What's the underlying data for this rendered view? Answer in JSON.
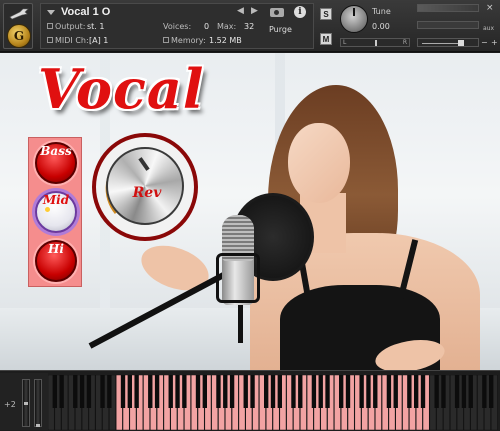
{
  "header": {
    "instrument_name": "Vocal 1 O",
    "output_label": "Output:",
    "output_value": "st. 1",
    "voices_label": "Voices:",
    "voices_value": "0",
    "max_label": "Max:",
    "max_value": "32",
    "purge_label": "Purge",
    "midi_label": "MIDI Ch:",
    "midi_value": "[A] 1",
    "memory_label": "Memory:",
    "memory_value": "1.52 MB",
    "solo_label": "S",
    "mute_label": "M",
    "tune_label": "Tune",
    "tune_value": "0.00",
    "aux_label": "aux",
    "pan_left": "L",
    "pan_right": "R",
    "close_glyph": "×",
    "badge_letter": "G",
    "nav_prev": "◀",
    "nav_next": "▶",
    "minus": "−",
    "plus": "+"
  },
  "panel": {
    "title": "Vocal",
    "buttons": [
      {
        "label": "Bass"
      },
      {
        "label": "Mid"
      },
      {
        "label": "Hi"
      }
    ],
    "knob_label": "Rev"
  },
  "keyboard": {
    "octave_label": "+2",
    "white_key_count": 66,
    "highlight_start": 10,
    "highlight_end": 56
  },
  "colors": {
    "title_red": "#e01010",
    "button_panel": "#f58d8d",
    "key_highlight": "#f2a3a3"
  },
  "icons": [
    "wrench-icon",
    "dropdown-triangle-icon",
    "camera-icon",
    "info-icon",
    "close-icon",
    "tune-knob",
    "rev-knob"
  ]
}
